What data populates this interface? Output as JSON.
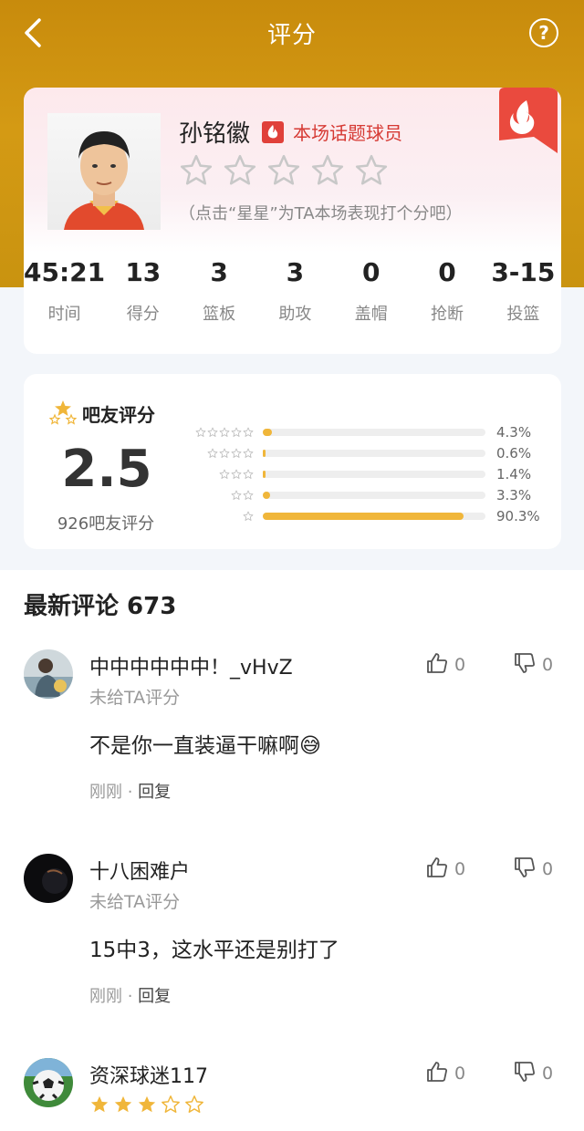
{
  "nav": {
    "title": "评分"
  },
  "player": {
    "name": "孙铭徽",
    "badge": "本场话题球员",
    "rate_hint": "（点击“星星”为TA本场表现打个分吧）",
    "rating_stars_total": 5
  },
  "stats": [
    {
      "value": "45:21",
      "label": "时间"
    },
    {
      "value": "13",
      "label": "得分"
    },
    {
      "value": "3",
      "label": "篮板"
    },
    {
      "value": "3",
      "label": "助攻"
    },
    {
      "value": "0",
      "label": "盖帽"
    },
    {
      "value": "0",
      "label": "抢断"
    },
    {
      "value": "3-15",
      "label": "投篮"
    }
  ],
  "fan_rating": {
    "title": "吧友评分",
    "score": "2.5",
    "count_text": "926吧友评分",
    "distribution": [
      {
        "stars": 5,
        "percent_text": "4.3%",
        "fraction": 0.043
      },
      {
        "stars": 4,
        "percent_text": "0.6%",
        "fraction": 0.006
      },
      {
        "stars": 3,
        "percent_text": "1.4%",
        "fraction": 0.014
      },
      {
        "stars": 2,
        "percent_text": "3.3%",
        "fraction": 0.033
      },
      {
        "stars": 1,
        "percent_text": "90.3%",
        "fraction": 0.903
      }
    ]
  },
  "comments_header": "最新评论 673",
  "comments": [
    {
      "user": "中中中中中中！_vHvZ",
      "rating_text": "未给TA评分",
      "text": "不是你一直装逼干嘛啊😅",
      "time": "刚刚",
      "reply_label": "回复",
      "likes": "0",
      "dislikes": "0"
    },
    {
      "user": "十八困难户",
      "rating_text": "未给TA评分",
      "text": "15中3，这水平还是别打了",
      "time": "刚刚",
      "reply_label": "回复",
      "likes": "0",
      "dislikes": "0"
    },
    {
      "user": "资深球迷117",
      "stars_filled": 3,
      "stars_total": 5,
      "likes": "0",
      "dislikes": "0"
    }
  ],
  "colors": {
    "header_gold": "#c88b0c",
    "accent_red": "#e0403a",
    "star_gold": "#f0b63a"
  }
}
